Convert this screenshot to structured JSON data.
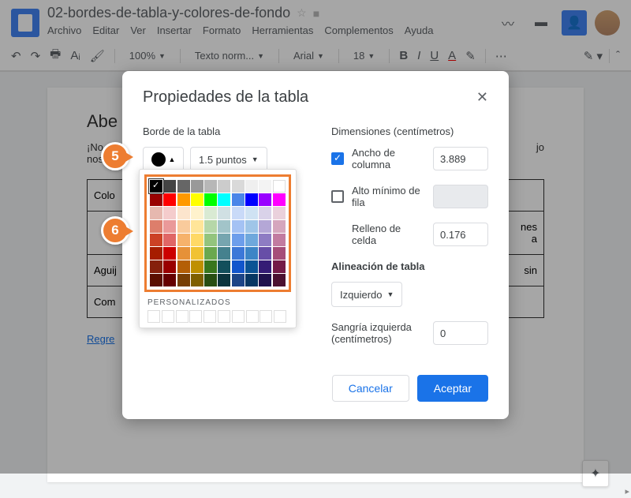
{
  "doc": {
    "title": "02-bordes-de-tabla-y-colores-de-fondo",
    "heading_partial": "Abe",
    "text_partial_left": "¡No d",
    "text_partial_right": "jo",
    "text_line2": "nos a",
    "rows": [
      "Colo",
      "",
      "Aguij",
      "Com"
    ],
    "row2_right_a": "nes",
    "row2_right_b": "a",
    "row3_right": "sin",
    "link": "Regre"
  },
  "menu": {
    "archivo": "Archivo",
    "editar": "Editar",
    "ver": "Ver",
    "insertar": "Insertar",
    "formato": "Formato",
    "herramientas": "Herramientas",
    "complementos": "Complementos",
    "ayuda": "Ayuda"
  },
  "toolbar": {
    "zoom": "100%",
    "style": "Texto norm...",
    "font": "Arial",
    "size": "18"
  },
  "dialog": {
    "title": "Propiedades de la tabla",
    "border_section": "Borde de la tabla",
    "border_width": "1.5 puntos",
    "dimensions_section": "Dimensiones  (centímetros)",
    "col_width_label": "Ancho de columna",
    "col_width_value": "3.889",
    "row_height_label": "Alto mínimo de fila",
    "cell_padding_label": "Relleno de celda",
    "cell_padding_value": "0.176",
    "alignment_section": "Alineación de tabla",
    "alignment_value": "Izquierdo",
    "indent_label": "Sangría izquierda  (centímetros)",
    "indent_value": "0",
    "cancel": "Cancelar",
    "accept": "Aceptar"
  },
  "picker": {
    "custom_label": "PERSONALIZADOS"
  },
  "badges": {
    "b5": "5",
    "b6": "6"
  },
  "colors": {
    "row1": [
      "#000000",
      "#434343",
      "#666666",
      "#999999",
      "#b7b7b7",
      "#cccccc",
      "#d9d9d9",
      "#efefef",
      "#f3f3f3",
      "#ffffff"
    ],
    "row2": [
      "#980000",
      "#ff0000",
      "#ff9900",
      "#ffff00",
      "#00ff00",
      "#00ffff",
      "#4a86e8",
      "#0000ff",
      "#9900ff",
      "#ff00ff"
    ],
    "row3": [
      "#e6b8af",
      "#f4cccc",
      "#fce5cd",
      "#fff2cc",
      "#d9ead3",
      "#d0e0e3",
      "#c9daf8",
      "#cfe2f3",
      "#d9d2e9",
      "#ead1dc"
    ],
    "row4": [
      "#dd7e6b",
      "#ea9999",
      "#f9cb9c",
      "#ffe599",
      "#b6d7a8",
      "#a2c4c9",
      "#a4c2f4",
      "#9fc5e8",
      "#b4a7d6",
      "#d5a6bd"
    ],
    "row5": [
      "#cc4125",
      "#e06666",
      "#f6b26b",
      "#ffd966",
      "#93c47d",
      "#76a5af",
      "#6d9eeb",
      "#6fa8dc",
      "#8e7cc3",
      "#c27ba0"
    ],
    "row6": [
      "#a61c00",
      "#cc0000",
      "#e69138",
      "#f1c232",
      "#6aa84f",
      "#45818e",
      "#3c78d8",
      "#3d85c6",
      "#674ea7",
      "#a64d79"
    ],
    "row7": [
      "#85200c",
      "#990000",
      "#b45f06",
      "#bf9000",
      "#38761d",
      "#134f5c",
      "#1155cc",
      "#0b5394",
      "#351c75",
      "#741b47"
    ],
    "row8": [
      "#5b0f00",
      "#660000",
      "#783f04",
      "#7f6000",
      "#274e13",
      "#0c343d",
      "#1c4587",
      "#073763",
      "#20124d",
      "#4c1130"
    ]
  }
}
